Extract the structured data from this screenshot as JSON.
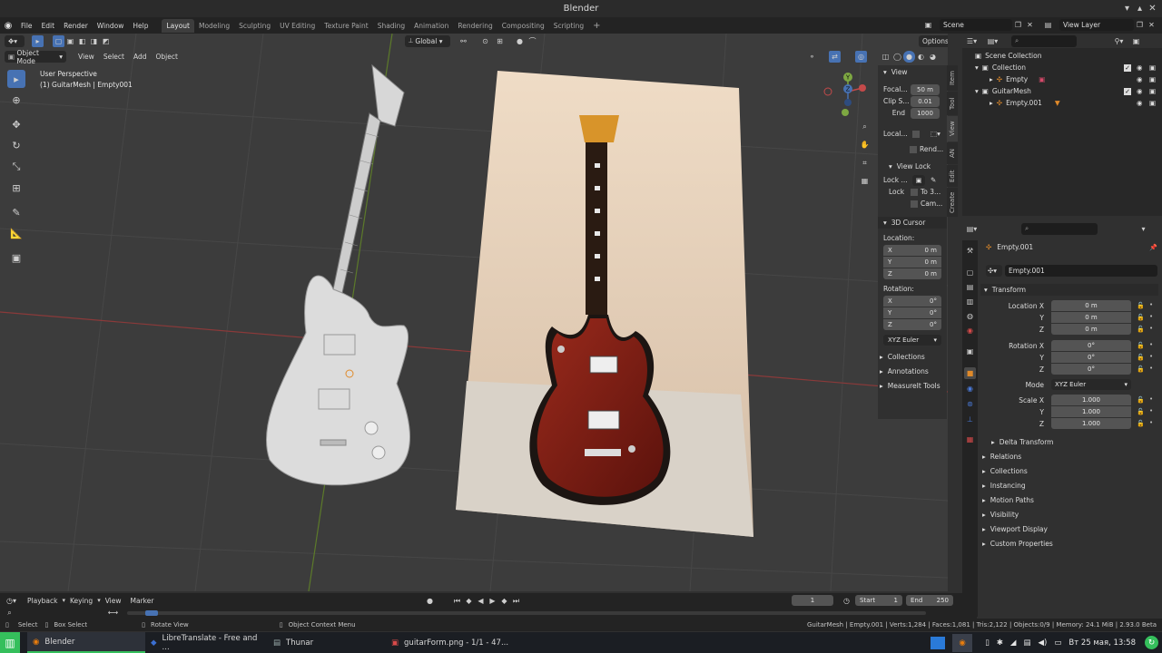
{
  "app": {
    "title": "Blender"
  },
  "menu": [
    "File",
    "Edit",
    "Render",
    "Window",
    "Help"
  ],
  "workspaces": [
    "Layout",
    "Modeling",
    "Sculpting",
    "UV Editing",
    "Texture Paint",
    "Shading",
    "Animation",
    "Rendering",
    "Compositing",
    "Scripting"
  ],
  "topbar": {
    "scene": "Scene",
    "view_layer": "View Layer"
  },
  "viewport": {
    "mode": "Object Mode",
    "menus": [
      "View",
      "Select",
      "Add",
      "Object"
    ],
    "orientation": "Global",
    "options": "Options",
    "perspective": "User Perspective",
    "active_object": "(1) GuitarMesh | Empty001",
    "gizmo_axes": {
      "x": "X",
      "y": "Y",
      "z": "Z"
    }
  },
  "npanel": {
    "tabs": [
      "Item",
      "Tool",
      "View",
      "AN",
      "Edit",
      "Create"
    ],
    "view": {
      "header": "View",
      "focal_label": "Focal...",
      "focal_value": "50 m",
      "clip_label": "Clip S...",
      "clip_start": "0.01",
      "end_label": "End",
      "clip_end": "1000",
      "local_label": "Local...",
      "render_label": "Rend..."
    },
    "view_lock": {
      "header": "View Lock",
      "lock_label": "Lock ...",
      "lock2_label": "Lock",
      "to3d": "To 3...",
      "cam": "Cam..."
    },
    "cursor": {
      "header": "3D Cursor",
      "location_label": "Location:",
      "loc_x_label": "X",
      "loc_x": "0 m",
      "loc_y_label": "Y",
      "loc_y": "0 m",
      "loc_z_label": "Z",
      "loc_z": "0 m",
      "rotation_label": "Rotation:",
      "rot_x_label": "X",
      "rot_x": "0°",
      "rot_y_label": "Y",
      "rot_y": "0°",
      "rot_z_label": "Z",
      "rot_z": "0°",
      "rot_mode": "XYZ Euler"
    },
    "collapsed": [
      "Collections",
      "Annotations",
      "MeasureIt Tools"
    ]
  },
  "outliner": {
    "scene_collection": "Scene Collection",
    "collection": "Collection",
    "empty": "Empty",
    "guitar_mesh": "GuitarMesh",
    "empty001": "Empty.001"
  },
  "properties": {
    "object_name_top": "Empty.001",
    "object_name_field": "Empty.001",
    "transform": {
      "header": "Transform",
      "location_x_label": "Location X",
      "location_x": "0 m",
      "location_y_label": "Y",
      "location_y": "0 m",
      "location_z_label": "Z",
      "location_z": "0 m",
      "rotation_x_label": "Rotation X",
      "rotation_x": "0°",
      "rotation_y_label": "Y",
      "rotation_y": "0°",
      "rotation_z_label": "Z",
      "rotation_z": "0°",
      "mode_label": "Mode",
      "mode_value": "XYZ Euler",
      "scale_x_label": "Scale X",
      "scale_x": "1.000",
      "scale_y_label": "Y",
      "scale_y": "1.000",
      "scale_z_label": "Z",
      "scale_z": "1.000",
      "delta": "Delta Transform"
    },
    "sections": [
      "Relations",
      "Collections",
      "Instancing",
      "Motion Paths",
      "Visibility",
      "Viewport Display",
      "Custom Properties"
    ]
  },
  "timeline": {
    "menus": [
      "Playback",
      "Keying",
      "View",
      "Marker"
    ],
    "current_frame": "1",
    "start_label": "Start",
    "start": "1",
    "end_label": "End",
    "end": "250"
  },
  "statusbar": {
    "select": "Select",
    "box_select": "Box Select",
    "rotate_view": "Rotate View",
    "context_menu": "Object Context Menu",
    "stats": "GuitarMesh | Empty.001 | Verts:1,284 | Faces:1,081 | Tris:2,122 | Objects:0/9 | Memory: 24.1 MiB | 2.93.0 Beta"
  },
  "taskbar": {
    "blender": "Blender",
    "libretranslate": "LibreTranslate - Free and ...",
    "thunar": "Thunar",
    "image": "guitarForm.png - 1/1 - 47...",
    "clock": "Вт 25 мая, 13:58"
  },
  "colors": {
    "accent": "#4772b3",
    "x_axis": "#c44a4a",
    "y_axis": "#7ea842",
    "bg": "#3c3c3c"
  }
}
